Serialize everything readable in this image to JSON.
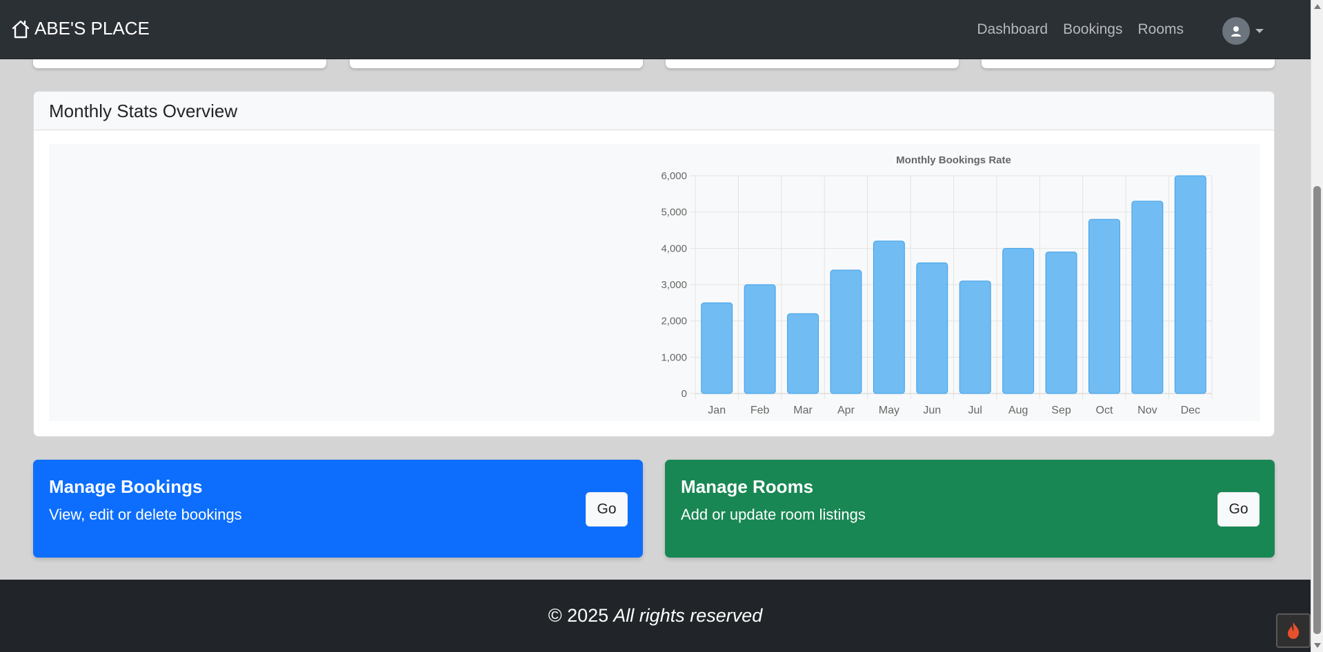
{
  "navbar": {
    "brand": "ABE'S PLACE",
    "links": [
      "Dashboard",
      "Bookings",
      "Rooms"
    ],
    "user_icon": "user-avatar-icon"
  },
  "stats": {
    "title": "Monthly Stats Overview"
  },
  "chart_data": {
    "type": "bar",
    "title": "Monthly Bookings Rate",
    "categories": [
      "Jan",
      "Feb",
      "Mar",
      "Apr",
      "May",
      "Jun",
      "Jul",
      "Aug",
      "Sep",
      "Oct",
      "Nov",
      "Dec"
    ],
    "values": [
      2500,
      3000,
      2200,
      3400,
      4200,
      3600,
      3100,
      4000,
      3900,
      4800,
      5300,
      6000
    ],
    "ylim": [
      0,
      6000
    ],
    "yticks": [
      "0",
      "1,000",
      "2,000",
      "3,000",
      "4,000",
      "5,000",
      "6,000"
    ],
    "grid": true,
    "bar_color": "#71bcf2",
    "bar_border": "#3ea0ea"
  },
  "actions": {
    "bookings": {
      "title": "Manage Bookings",
      "desc": "View, edit or delete bookings",
      "button": "Go",
      "color": "#0d6efd"
    },
    "rooms": {
      "title": "Manage Rooms",
      "desc": "Add or update room listings",
      "button": "Go",
      "color": "#198754"
    }
  },
  "footer": {
    "copyright": "© 2025",
    "rights": "All rights reserved"
  }
}
